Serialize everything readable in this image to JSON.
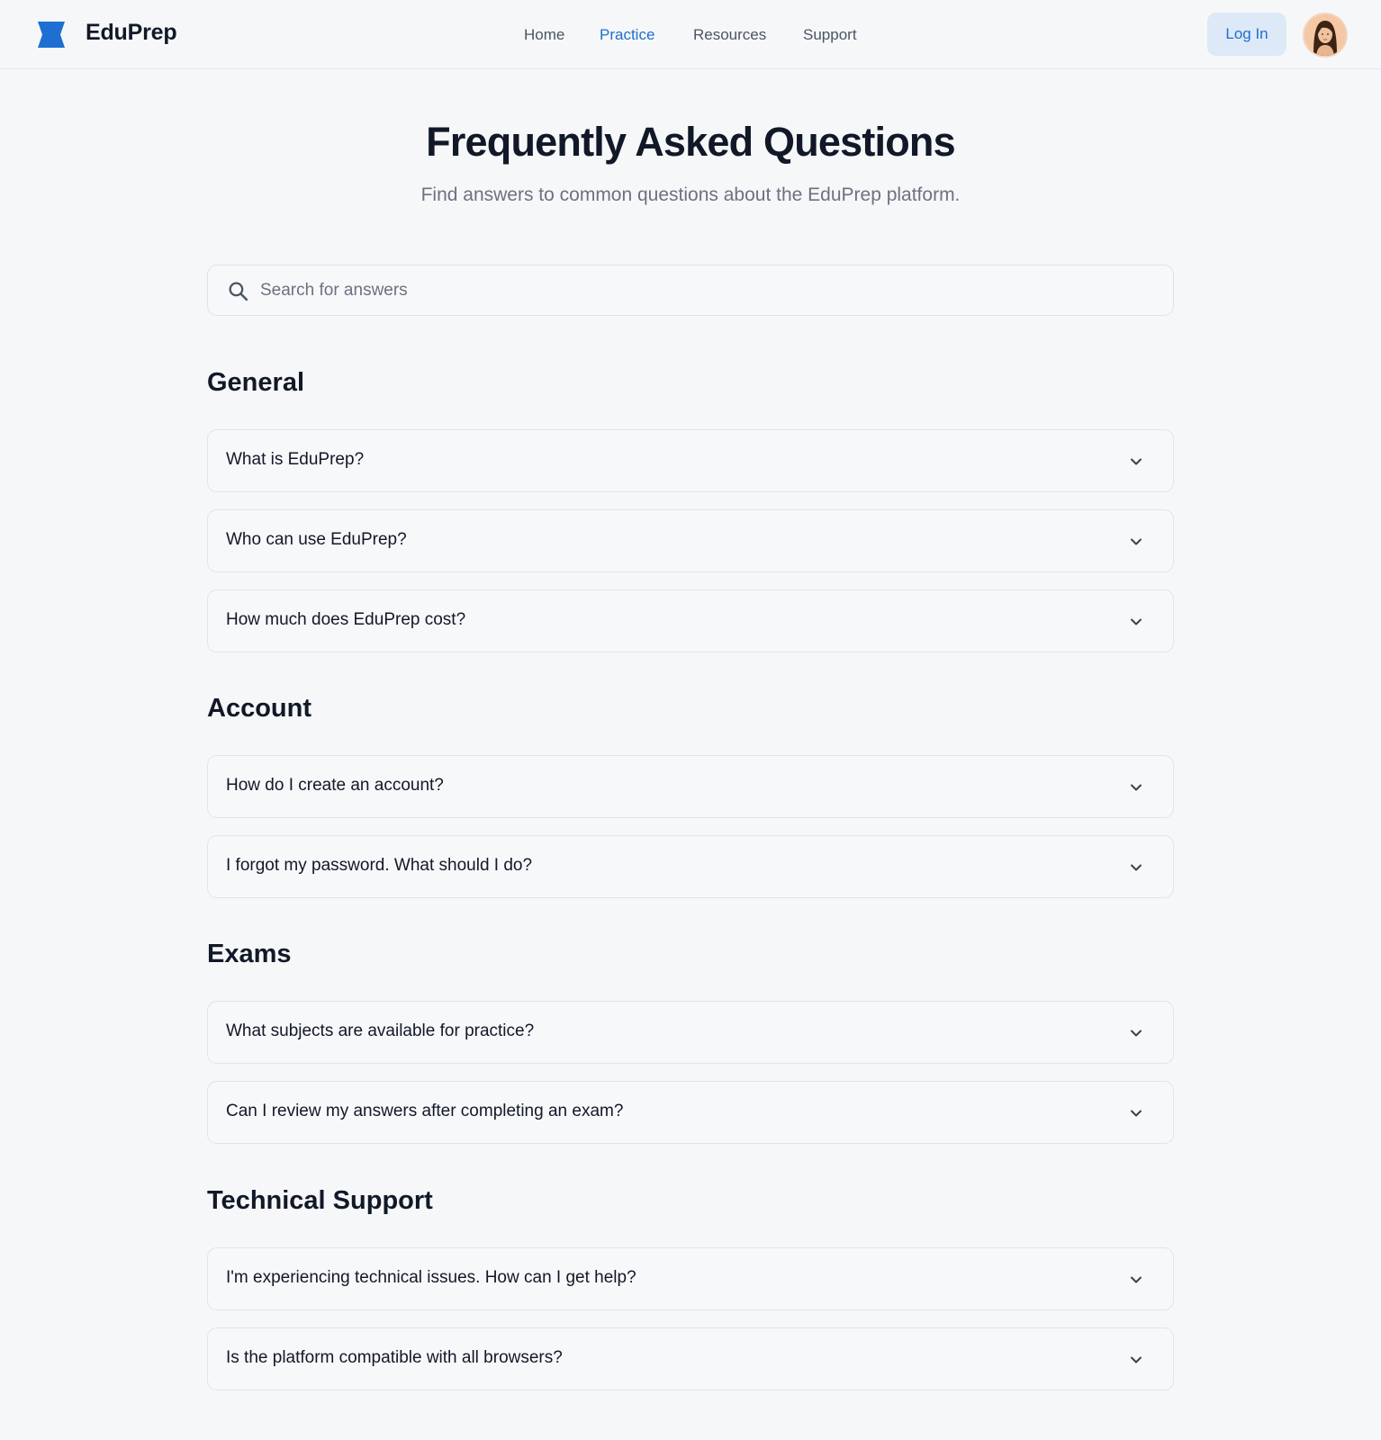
{
  "header": {
    "brand": "EduPrep",
    "brand_color": "#1d6fd1",
    "nav": [
      {
        "label": "Home",
        "active": false
      },
      {
        "label": "Practice",
        "active": true
      },
      {
        "label": "Resources",
        "active": false
      },
      {
        "label": "Support",
        "active": false
      }
    ],
    "login_label": "Log In"
  },
  "hero": {
    "title": "Frequently Asked Questions",
    "subtitle": "Find answers to common questions about the EduPrep platform."
  },
  "search": {
    "placeholder": "Search for answers",
    "value": ""
  },
  "sections": [
    {
      "title": "General",
      "questions": [
        "What is EduPrep?",
        "Who can use EduPrep?",
        "How much does EduPrep cost?"
      ]
    },
    {
      "title": "Account",
      "questions": [
        "How do I create an account?",
        "I forgot my password. What should I do?"
      ]
    },
    {
      "title": "Exams",
      "questions": [
        "What subjects are available for practice?",
        "Can I review my answers after completing an exam?"
      ]
    },
    {
      "title": "Technical Support",
      "questions": [
        "I'm experiencing technical issues. How can I get help?",
        "Is the platform compatible with all browsers?"
      ]
    }
  ]
}
